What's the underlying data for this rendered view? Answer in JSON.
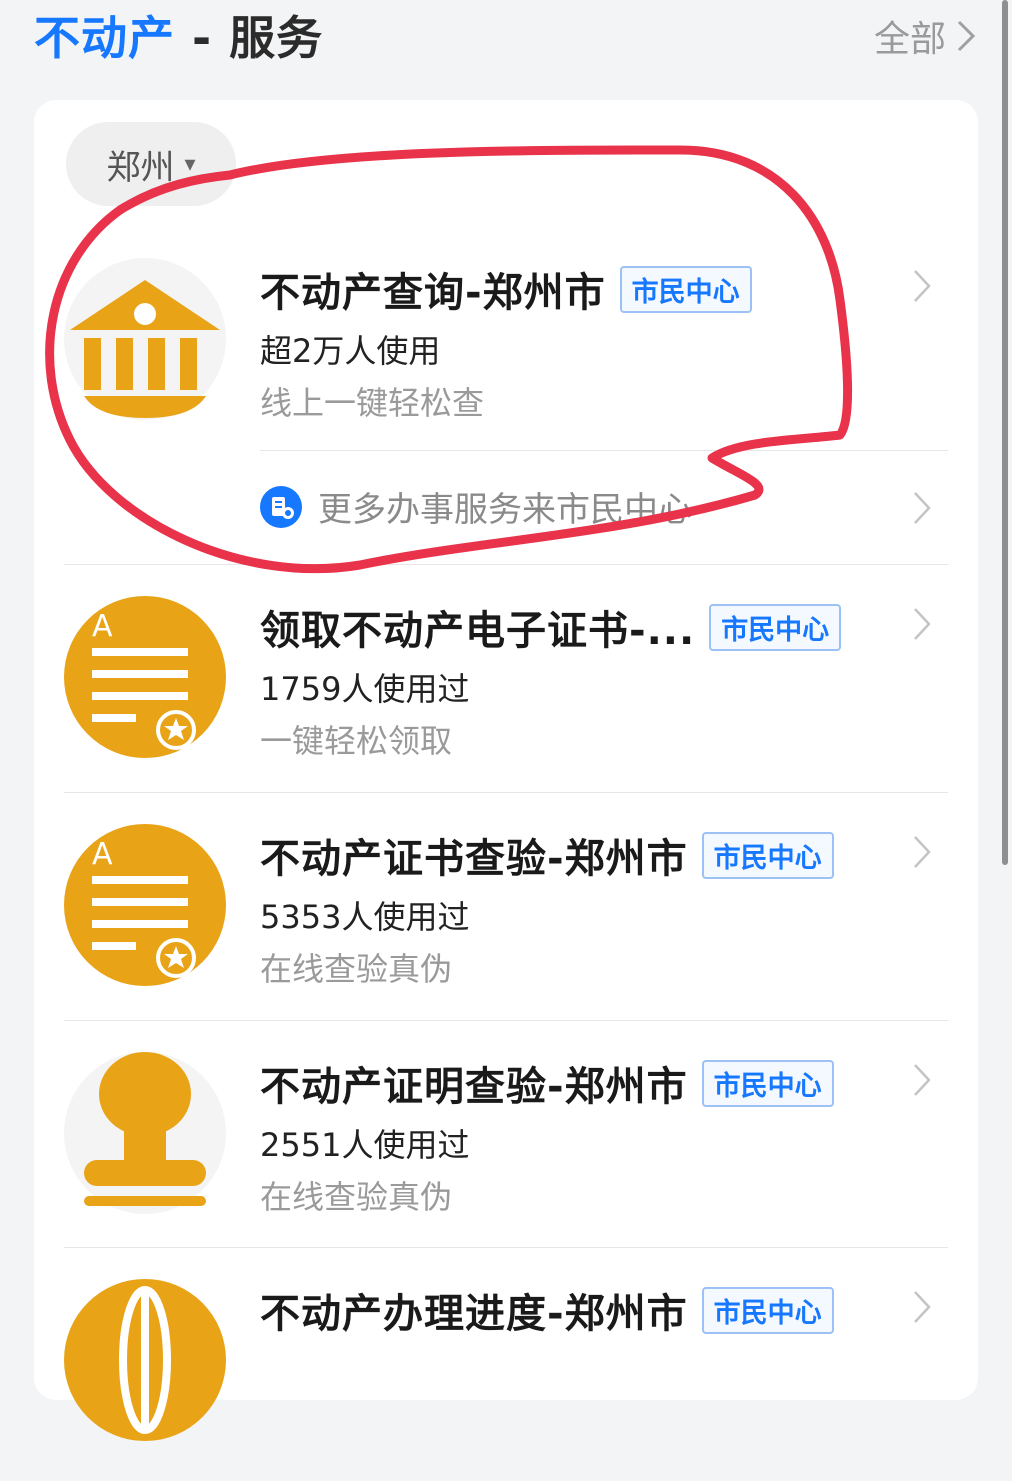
{
  "header": {
    "title_highlight": "不动产",
    "title_rest": " - 服务",
    "all_label": "全部"
  },
  "city": "郑州",
  "colors": {
    "accent": "#1677ff",
    "icon": "#e8a317",
    "annotation": "#e8334a"
  },
  "services": [
    {
      "name": "不动产查询-郑州市",
      "badge": "市民中心",
      "usage": "超2万人使用",
      "desc": "线上一键轻松查",
      "icon": "bank-icon"
    },
    {
      "name": "领取不动产电子证书-...",
      "badge": "市民中心",
      "usage": "1759人使用过",
      "desc": "一键轻松领取",
      "icon": "certificate-icon"
    },
    {
      "name": "不动产证书查验-郑州市",
      "badge": "市民中心",
      "usage": "5353人使用过",
      "desc": "在线查验真伪",
      "icon": "certificate-icon"
    },
    {
      "name": "不动产证明查验-郑州市",
      "badge": "市民中心",
      "usage": "2551人使用过",
      "desc": "在线查验真伪",
      "icon": "stamp-icon"
    },
    {
      "name": "不动产办理进度-郑州市",
      "badge": "市民中心",
      "usage": "",
      "desc": "",
      "icon": "globe-icon"
    }
  ],
  "more_services": "更多办事服务来市民中心"
}
